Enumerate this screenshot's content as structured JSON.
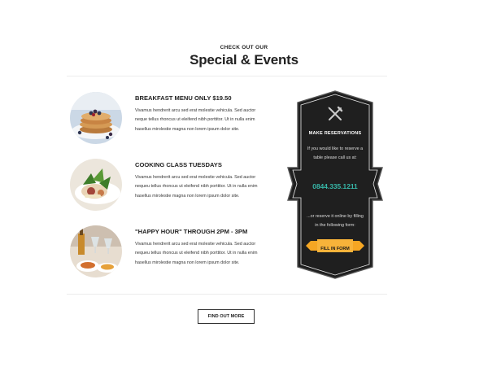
{
  "header": {
    "eyebrow": "CHECK OUT OUR",
    "title": "Special & Events"
  },
  "events": [
    {
      "title": "BREAKFAST MENU ONLY $19.50",
      "description": "Vivamus hendrerit arcu sed erat molestie vehicula. Sed auctor neque tellus rhoncus ut eleifend nibh porttitor. Ut in nulla enim hasellus mirolestie magna non lorem ipsum dolor site.",
      "image": "pancakes-with-berries"
    },
    {
      "title": "COOKING CLASS TUESDAYS",
      "description": "Vivamus hendrerit arcu sed erat molestie vehicula. Sed auctor nequeu tellus rhoncus ut eleifend nibh porttitor. Ut in nulla enim hasellus mirolestie magna non lorem ipsum dolor site.",
      "image": "salad-plate"
    },
    {
      "title": "\"HAPPY HOUR\" THROUGH 2PM - 3PM",
      "description": "Vivamus hendrerit arcu sed erat molestie vehicula. Sed auctor nequeu tellus rhoncus ut eleifend nibh porttitor. Ut in nulla enim hasellus mirolestie magna non lorem ipsum dolor site.",
      "image": "drinks-and-food"
    }
  ],
  "reservation": {
    "icon": "fork-knife-icon",
    "title": "MAKE RESERVATIONS",
    "line1": "If you would like to reserve a",
    "line2": "table please call us at:",
    "phone": "0844.335.1211",
    "line3": "...or reserve it online by filling",
    "line4": "in the following form:",
    "button": "FILL IN FORM",
    "colors": {
      "card": "#1f1f1f",
      "phone": "#37b7a8",
      "ribbon": "#f5a623"
    }
  },
  "footer": {
    "button": "FIND OUT MORE"
  }
}
